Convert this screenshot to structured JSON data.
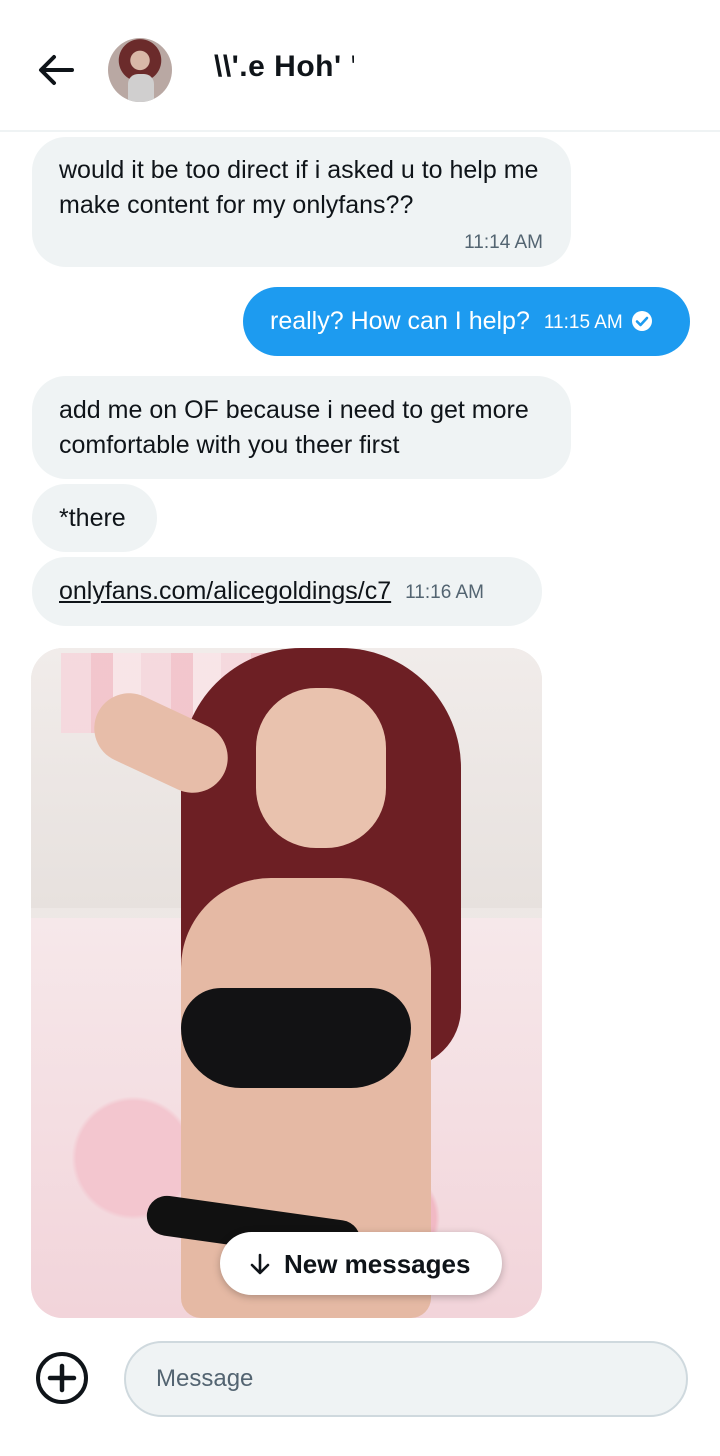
{
  "header": {
    "title": "\\\\'.e Hoh' '",
    "back_icon": "arrow-left-icon",
    "avatar_icon": "profile-avatar"
  },
  "messages": [
    {
      "direction": "received",
      "text": "would it be too direct if i asked u to help me make content for my onlyfans??",
      "time": "11:14 AM"
    },
    {
      "direction": "sent",
      "text": "really? How can I help?",
      "time": "11:15 AM",
      "status_icon": "check-circle-icon"
    },
    {
      "direction": "received",
      "text": "add me on OF because i need to get more comfortable with you theer first",
      "time": ""
    },
    {
      "direction": "received",
      "text": "*there",
      "time": ""
    },
    {
      "direction": "received",
      "link": "onlyfans.com/alicegoldings/c7",
      "time": "11:16 AM"
    },
    {
      "direction": "received",
      "type": "photo"
    }
  ],
  "new_messages": {
    "label": "New messages",
    "icon": "arrow-down-icon"
  },
  "composer": {
    "placeholder": "Message",
    "add_icon": "plus-circle-icon"
  },
  "colors": {
    "accent": "#1d9bf0",
    "bubble_received": "#eff3f4",
    "text": "#0f1419",
    "muted": "#536471"
  }
}
